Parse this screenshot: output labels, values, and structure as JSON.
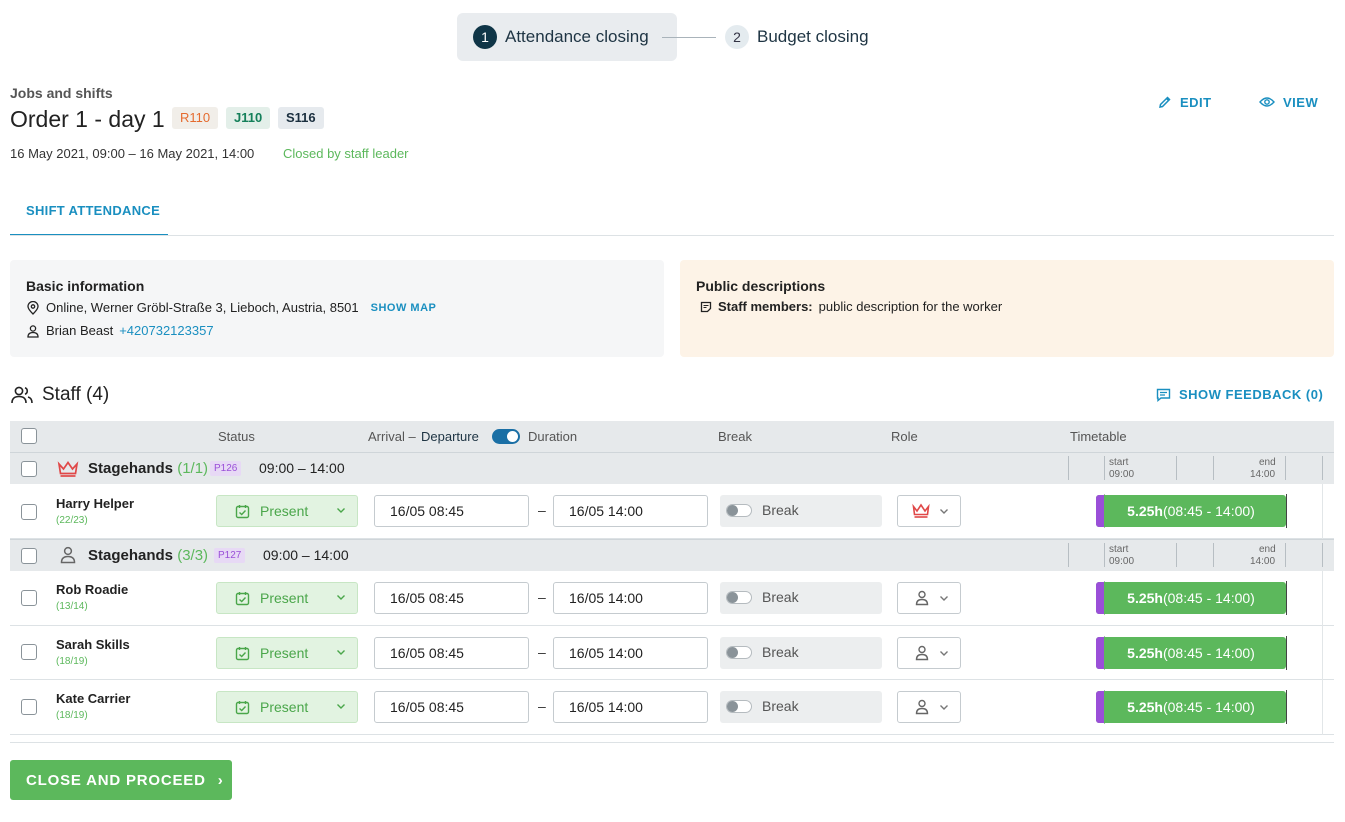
{
  "stepper": {
    "steps": [
      {
        "number": "1",
        "label": "Attendance closing",
        "active": true
      },
      {
        "number": "2",
        "label": "Budget closing",
        "active": false
      }
    ]
  },
  "header": {
    "section_label": "Jobs and shifts",
    "title": "Order 1 - day 1",
    "badges": [
      "R110",
      "J110",
      "S116"
    ],
    "dates": "16 May 2021, 09:00 – 16 May 2021, 14:00",
    "status": "Closed by staff leader",
    "edit_label": "EDIT",
    "view_label": "VIEW"
  },
  "tabs": [
    {
      "label": "SHIFT ATTENDANCE",
      "active": true
    }
  ],
  "basic_info": {
    "title": "Basic information",
    "address": "Online, Werner Gröbl-Straße 3, Lieboch, Austria, 8501",
    "show_map": "SHOW MAP",
    "contact_name": "Brian Beast",
    "contact_phone": "+420732123357"
  },
  "public_descriptions": {
    "title": "Public descriptions",
    "label": "Staff members:",
    "text": "public description for the worker"
  },
  "staff": {
    "title": "Staff (4)",
    "feedback_label": "SHOW FEEDBACK (0)",
    "columns": {
      "status": "Status",
      "arrival": "Arrival –",
      "departure": "Departure",
      "duration": "Duration",
      "break": "Break",
      "role": "Role",
      "timetable": "Timetable"
    },
    "departure_toggle_on": true,
    "groups": [
      {
        "name": "Stagehands",
        "count": "(1/1)",
        "position": "P126",
        "time": "09:00 – 14:00",
        "role_icon": "crown-icon",
        "timeline": {
          "start_label": "start",
          "start_time": "09:00",
          "end_label": "end",
          "end_time": "14:00"
        },
        "members": [
          {
            "name": "Harry Helper",
            "count_a": "22",
            "count_b": "23",
            "status": "Present",
            "arrival": "16/05  08:45",
            "departure": "16/05  14:00",
            "break": "Break",
            "break_on": false,
            "hours": "5.25h",
            "range": "(08:45 - 14:00)"
          }
        ]
      },
      {
        "name": "Stagehands",
        "count": "(3/3)",
        "position": "P127",
        "time": "09:00 – 14:00",
        "role_icon": "person-icon",
        "timeline": {
          "start_label": "start",
          "start_time": "09:00",
          "end_label": "end",
          "end_time": "14:00"
        },
        "members": [
          {
            "name": "Rob Roadie",
            "count_a": "13",
            "count_b": "14",
            "status": "Present",
            "arrival": "16/05  08:45",
            "departure": "16/05  14:00",
            "break": "Break",
            "break_on": false,
            "hours": "5.25h",
            "range": "(08:45 - 14:00)"
          },
          {
            "name": "Sarah Skills",
            "count_a": "18",
            "count_b": "19",
            "status": "Present",
            "arrival": "16/05  08:45",
            "departure": "16/05  14:00",
            "break": "Break",
            "break_on": false,
            "hours": "5.25h",
            "range": "(08:45 - 14:00)"
          },
          {
            "name": "Kate Carrier",
            "count_a": "18",
            "count_b": "19",
            "status": "Present",
            "arrival": "16/05  08:45",
            "departure": "16/05  14:00",
            "break": "Break",
            "break_on": false,
            "hours": "5.25h",
            "range": "(08:45 - 14:00)"
          }
        ]
      }
    ]
  },
  "footer": {
    "proceed_label": "CLOSE AND PROCEED",
    "proceed_arrow": "›"
  },
  "colors": {
    "accent": "#1a8fc0",
    "success": "#5cb85c",
    "purple": "#9a4fd8",
    "leader": "#e04848",
    "active_step": "#0f3547"
  }
}
